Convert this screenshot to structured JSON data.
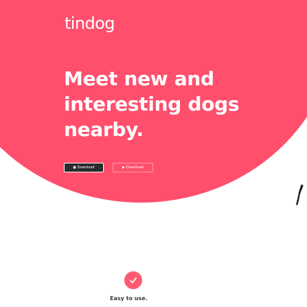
{
  "brand": {
    "name": "tindog"
  },
  "hero": {
    "line1": "Meet new and",
    "line2": "interesting dogs",
    "line3": "nearby."
  },
  "downloads": {
    "ios_label": "Download",
    "play_label": "Download"
  },
  "features": [
    {
      "title": "Easy to use."
    }
  ],
  "colors": {
    "accent": "#ff4f6d",
    "check_circle": "#ff5a73",
    "text_dark": "#3a3a3a"
  },
  "icons": {
    "ios": "apple-icon",
    "play": "play-store-icon",
    "feature": "check-circle-icon"
  }
}
